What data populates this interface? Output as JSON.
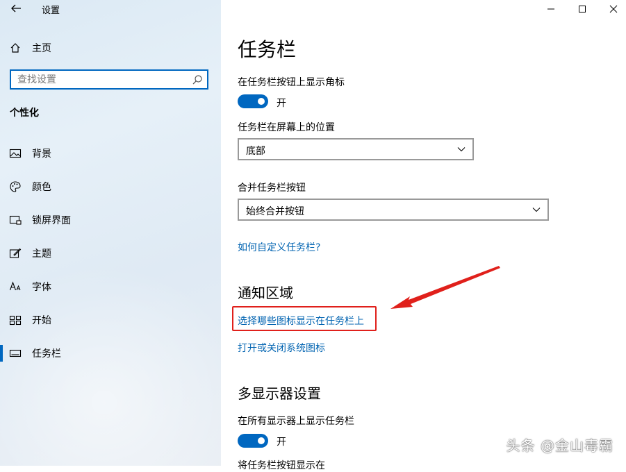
{
  "window": {
    "title": "设置",
    "controls": [
      "minimize-icon",
      "maximize-icon",
      "close-icon"
    ]
  },
  "sidebar": {
    "home_label": "主页",
    "search_placeholder": "查找设置",
    "section_title": "个性化",
    "items": [
      {
        "icon": "image-icon",
        "label": "背景"
      },
      {
        "icon": "palette-icon",
        "label": "颜色"
      },
      {
        "icon": "lock-screen-icon",
        "label": "锁屏界面"
      },
      {
        "icon": "theme-brush-icon",
        "label": "主题"
      },
      {
        "icon": "font-icon",
        "label": "字体"
      },
      {
        "icon": "start-menu-icon",
        "label": "开始"
      },
      {
        "icon": "taskbar-icon",
        "label": "任务栏",
        "active": true
      }
    ]
  },
  "main": {
    "title": "任务栏",
    "badges_label": "在任务栏按钮上显示角标",
    "badges_toggle_text": "开",
    "position_label": "任务栏在屏幕上的位置",
    "position_value": "底部",
    "combine_label": "合并任务栏按钮",
    "combine_value": "始终合并按钮",
    "customize_link": "如何自定义任务栏?",
    "notification_heading": "通知区域",
    "select_icons_link": "选择哪些图标显示在任务栏上",
    "system_icons_link": "打开或关闭系统图标",
    "multi_display_heading": "多显示器设置",
    "show_all_label": "在所有显示器上显示任务栏",
    "show_all_toggle_text": "开",
    "partial_label": "将任务栏按钮显示在"
  },
  "annotation": {
    "color": "#e0201b"
  },
  "watermark": "头条 @金山毒霸",
  "colors": {
    "accent": "#0067c0",
    "link": "#0063b1"
  }
}
